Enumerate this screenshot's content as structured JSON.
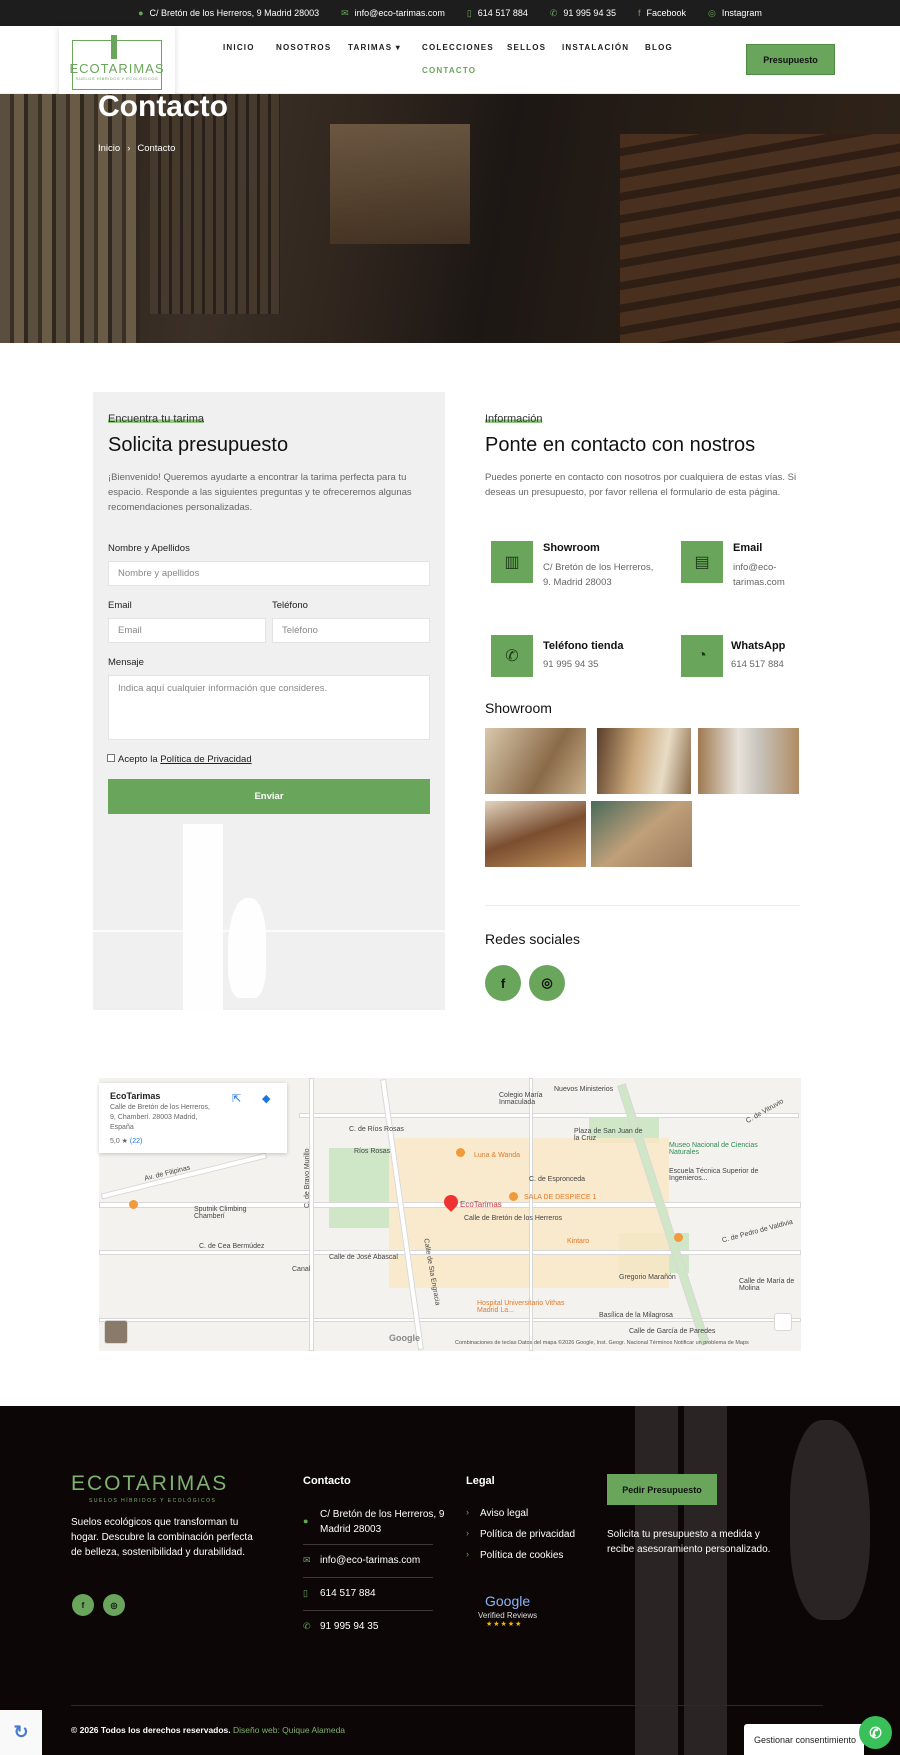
{
  "topbar": {
    "address": "C/ Bretón de los Herreros, 9 Madrid 28003",
    "email": "info@eco-tarimas.com",
    "mobile": "614 517 884",
    "phone": "91 995 94 35",
    "facebook": "Facebook",
    "instagram": "Instagram"
  },
  "brand": {
    "name": "ECOTARIMAS",
    "tagline": "SUELOS HÍBRIDOS Y ECOLÓGICOS",
    "accent": "#6aa55c"
  },
  "nav": {
    "items": [
      "INICIO",
      "NOSOTROS",
      "TARIMAS",
      "COLECCIONES",
      "SELLOS",
      "INSTALACIÓN",
      "BLOG"
    ],
    "active": "CONTACTO",
    "cta": "Presupuesto"
  },
  "hero": {
    "title": "Contacto",
    "breadcrumb": [
      "Inicio",
      "Contacto"
    ]
  },
  "form": {
    "eyebrow": "Encuentra tu tarima",
    "title": "Solicita presupuesto",
    "intro": "¡Bienvenido! Queremos ayudarte a encontrar la tarima perfecta para tu espacio. Responde a las siguientes preguntas y te ofreceremos algunas recomendaciones personalizadas.",
    "name_label": "Nombre y Apellidos",
    "name_placeholder": "Nombre y apellidos",
    "email_label": "Email",
    "email_placeholder": "Email",
    "phone_label": "Teléfono",
    "phone_placeholder": "Teléfono",
    "message_label": "Mensaje",
    "message_placeholder": "Indica aquí cualquier información que consideres.",
    "accept_prefix": "Acepto la",
    "privacy_link": "Política de Privacidad",
    "submit": "Enviar"
  },
  "info": {
    "eyebrow": "Información",
    "title": "Ponte en contacto con nostros",
    "intro": "Puedes ponerte en contacto con nosotros por cualquiera de estas vías. Si deseas un presupuesto, por favor rellena el formulario de esta página.",
    "cards": [
      {
        "title": "Showroom",
        "line1": "C/ Bretón de los Herreros,",
        "line2": "9. Madrid 28003",
        "icon": "building-icon"
      },
      {
        "title": "Email",
        "line1": "info@eco-",
        "line2": "tarimas.com",
        "icon": "office-icon"
      },
      {
        "title": "Teléfono tienda",
        "line1": "91 995 94 35",
        "line2": "",
        "icon": "phone-icon"
      },
      {
        "title": "WhatsApp",
        "line1": "614 517 884",
        "line2": "",
        "icon": "whatsapp-icon"
      }
    ],
    "showroom_title": "Showroom",
    "social_title": "Redes sociales"
  },
  "map": {
    "place": "EcoTarimas",
    "address_line1": "Calle de Bretón de los Herreros,",
    "address_line2": "9, Chamberí. 28003 Madrid,",
    "address_line3": "España",
    "rating": "5,0 ★",
    "reviews": "(22)",
    "pin_label": "EcoTarimas",
    "labels": [
      "C. de Ríos Rosas",
      "Ríos Rosas",
      "Luna & Wanda",
      "Colegio María Inmaculada",
      "Nuevos Ministerios",
      "Museo Nacional de Ciencias Naturales",
      "Escuela Técnica Superior de Ingenieros...",
      "C. de Espronceda",
      "SALA DE DESPIECE 1",
      "Calle de Bretón de los Herreros",
      "Kintaro",
      "Av. de Filipinas",
      "Sputnik Climbing Chamberí",
      "C. de Cea Bermúdez",
      "Calle de José Abascal",
      "Canal",
      "Gregorio Marañón",
      "Hospital Universitario Vithas Madrid La...",
      "Basílica de la Milagrosa",
      "Calle de García de Paredes",
      "Plaza de San Juan de la Cruz",
      "C. de Bravo Murillo",
      "Calle de Sta Engracia",
      "C. de Vitruvio",
      "C. de Pedro de Valdivia",
      "Calle de María de Molina"
    ],
    "footer": "Combinaciones de teclas   Datos del mapa ©2026 Google, Inst. Geogr. Nacional   Términos   Notificar un problema de Maps",
    "google": "Google"
  },
  "footer": {
    "about": "Suelos ecológicos que transforman tu hogar. Descubre la combinación perfecta de belleza, sostenibilidad y durabilidad.",
    "contact_title": "Contacto",
    "address1": "C/ Bretón de los Herreros, 9",
    "address2": "Madrid 28003",
    "email": "info@eco-tarimas.com",
    "mobile": "614 517 884",
    "phone": "91 995 94 35",
    "legal_title": "Legal",
    "legal": [
      "Aviso legal",
      "Política de privacidad",
      "Política de cookies"
    ],
    "cta": "Pedir Presupuesto",
    "cta_text": "Solicita tu presupuesto a medida y recibe asesoramiento personalizado.",
    "badge_brand": "Google",
    "badge_text": "Verified Reviews",
    "copyright": "© 2026 Todos los derechos reservados.",
    "credit": "Diseño web: Quique Alameda"
  },
  "overlays": {
    "cookie": "Gestionar consentimiento"
  }
}
